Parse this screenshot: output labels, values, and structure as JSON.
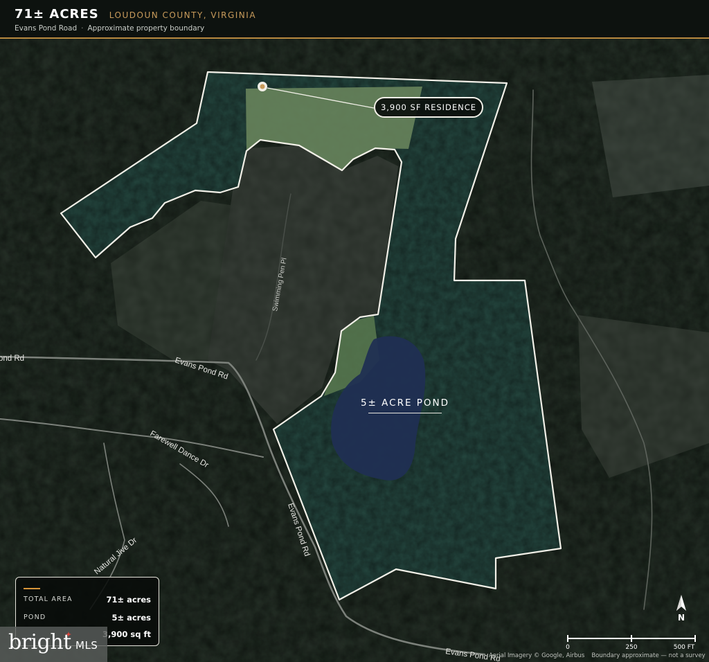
{
  "header": {
    "title": "71± ACRES",
    "location": "LOUDOUN COUNTY, VIRGINIA",
    "road": "Evans Pond Road",
    "separator": "·",
    "note": "Approximate property boundary"
  },
  "callouts": {
    "residence": "3,900 SF RESIDENCE",
    "pond": "5± ACRE POND"
  },
  "road_labels": {
    "evans_pond_rd_west": "ond Rd",
    "evans_pond_rd_mid": "Evans Pond Rd",
    "evans_pond_rd_south": "Evans Pond Rd",
    "evans_pond_rd_bottom": "Evans Pond Rd",
    "swimming_pen_pl": "Swimming Pen Pl",
    "farewell_dance_dr": "Farewell Dance Dr",
    "natural_jive_dr": "Natural Jive Dr"
  },
  "stats": {
    "rows": [
      {
        "label": "TOTAL AREA",
        "value": "71± acres"
      },
      {
        "label": "POND",
        "value": "5± acres"
      },
      {
        "label": "",
        "value": "3,900 sq ft"
      }
    ]
  },
  "logo": {
    "word": "bright",
    "suffix": "MLS"
  },
  "north": {
    "letter": "N"
  },
  "scale": {
    "ticks": [
      "0",
      "250",
      "500 FT"
    ]
  },
  "credits": {
    "imagery": "Aerial Imagery © Google, Airbus",
    "disclaimer": "Boundary approximate — not a survey"
  },
  "colors": {
    "accent": "#c89b5b",
    "header_rule": "#b8893f",
    "boundary": "#f2f0e8",
    "forest": "#1f3a2f",
    "pond": "#1c2a52",
    "meadow": "#6f8a5c"
  }
}
